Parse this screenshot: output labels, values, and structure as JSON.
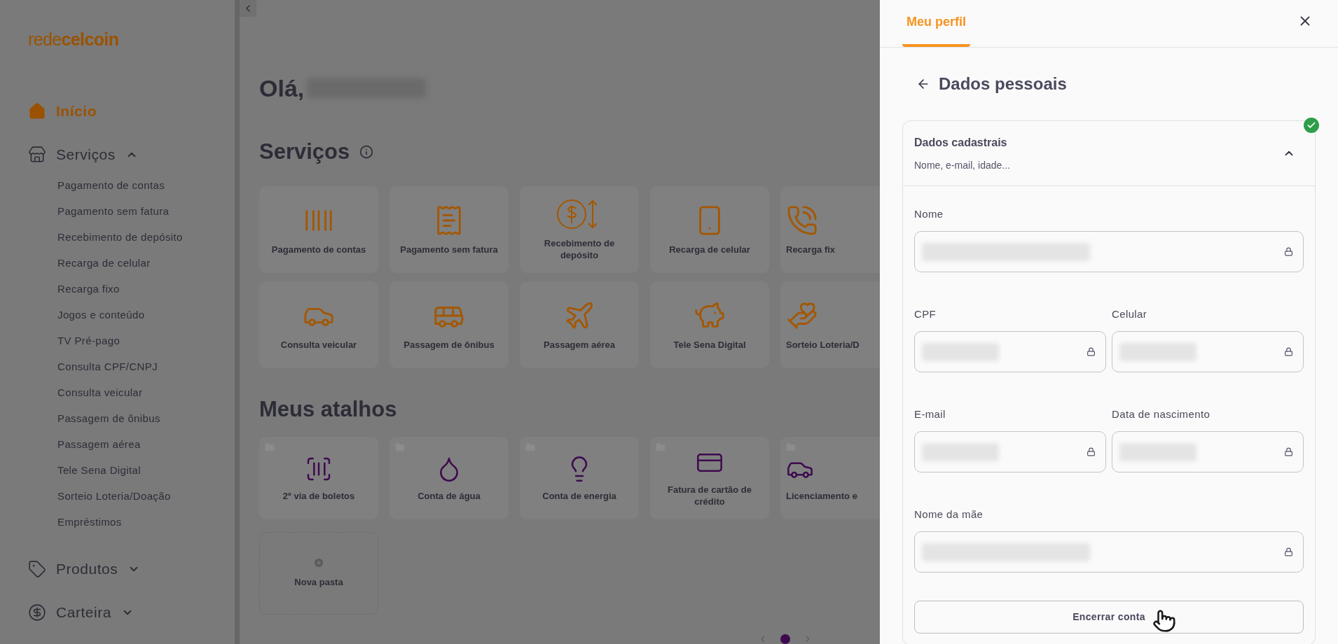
{
  "sidebar": {
    "logo": "rede**celcoin**",
    "nav": [
      {
        "kind": "link",
        "label": "Início",
        "selected": true
      },
      {
        "kind": "group",
        "label": "Serviços",
        "selected": false,
        "expanded": true,
        "children": [
          "Pagamento de contas",
          "Pagamento sem fatura",
          "Recebimento de depósito",
          "Recarga de celular",
          "Recarga fixo",
          "Jogos e conteúdo",
          "TV Pré-pago",
          "Consulta CPF/CNPJ",
          "Consulta veicular",
          "Passagem de ônibus",
          "Passagem aérea",
          "Tele Sena Digital",
          "Sorteio Loteria/Doação",
          "Empréstimos"
        ]
      },
      {
        "kind": "group",
        "label": "Produtos",
        "selected": false,
        "expanded": false
      },
      {
        "kind": "group",
        "label": "Carteira",
        "selected": false,
        "expanded": false
      }
    ]
  },
  "main": {
    "greeting": "Olá,",
    "services": {
      "title": "Serviços",
      "items": [
        "Pagamento de contas",
        "Pagamento sem fatura",
        "Recebimento de depósito",
        "Recarga de celular",
        "Recarga fix",
        "Consulta veicular",
        "Passagem de ônibus",
        "Passagem aérea",
        "Tele Sena Digital",
        "Sorteio Loteria/D"
      ]
    },
    "shortcuts": {
      "title": "Meus atalhos",
      "items": [
        "2º via de boletos",
        "Conta de água",
        "Conta de energia",
        "Fatura de cartão de crédito",
        "Licenciamento e"
      ],
      "new_folder": "Nova pasta"
    },
    "pagination": {
      "pages": [
        {
          "selected": true
        }
      ]
    }
  },
  "panel": {
    "tabs": [
      {
        "label": "Meu perfil",
        "selected": true
      }
    ],
    "title": "Dados pessoais",
    "section": {
      "title": "Dados cadastrais",
      "subtitle": "Nome, e-mail, idade...",
      "expanded": true,
      "complete": true,
      "rows": [
        [
          {
            "label": "Nome"
          }
        ],
        [
          {
            "label": "CPF"
          },
          {
            "label": "Celular"
          }
        ],
        [
          {
            "label": "E-mail"
          },
          {
            "label": "Data de nascimento"
          }
        ],
        [
          {
            "label": "Nome da mãe"
          }
        ]
      ],
      "button": "Encerrar conta"
    }
  }
}
